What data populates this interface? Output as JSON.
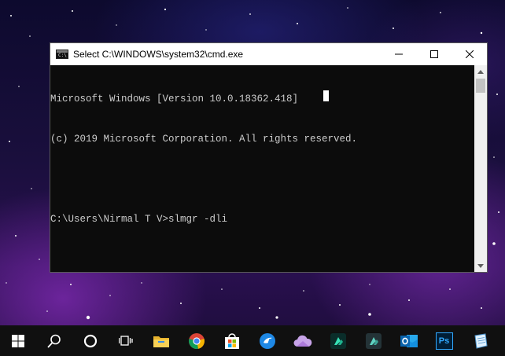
{
  "window": {
    "title": "Select C:\\WINDOWS\\system32\\cmd.exe",
    "app_icon_text": "C:\\"
  },
  "console": {
    "lines": [
      "Microsoft Windows [Version 10.0.18362.418]",
      "(c) 2019 Microsoft Corporation. All rights reserved.",
      "",
      "C:\\Users\\Nirmal T V>slmgr -dli"
    ]
  },
  "colors": {
    "console_background": "#0c0c0c",
    "console_text": "#cccccc",
    "taskbar": "#101010",
    "titlebar": "#ffffff"
  },
  "taskbar": {
    "icons": [
      "windows-start-icon",
      "search-icon",
      "cortana-icon",
      "task-view-icon",
      "file-explorer-icon",
      "chrome-icon",
      "microsoft-store-icon",
      "app-bird-icon",
      "onedrive-cloud-icon",
      "filmora-icon",
      "filmora-alt-icon",
      "outlook-icon",
      "photoshop-icon",
      "notepad-icon"
    ],
    "photoshop_label": "Ps"
  }
}
